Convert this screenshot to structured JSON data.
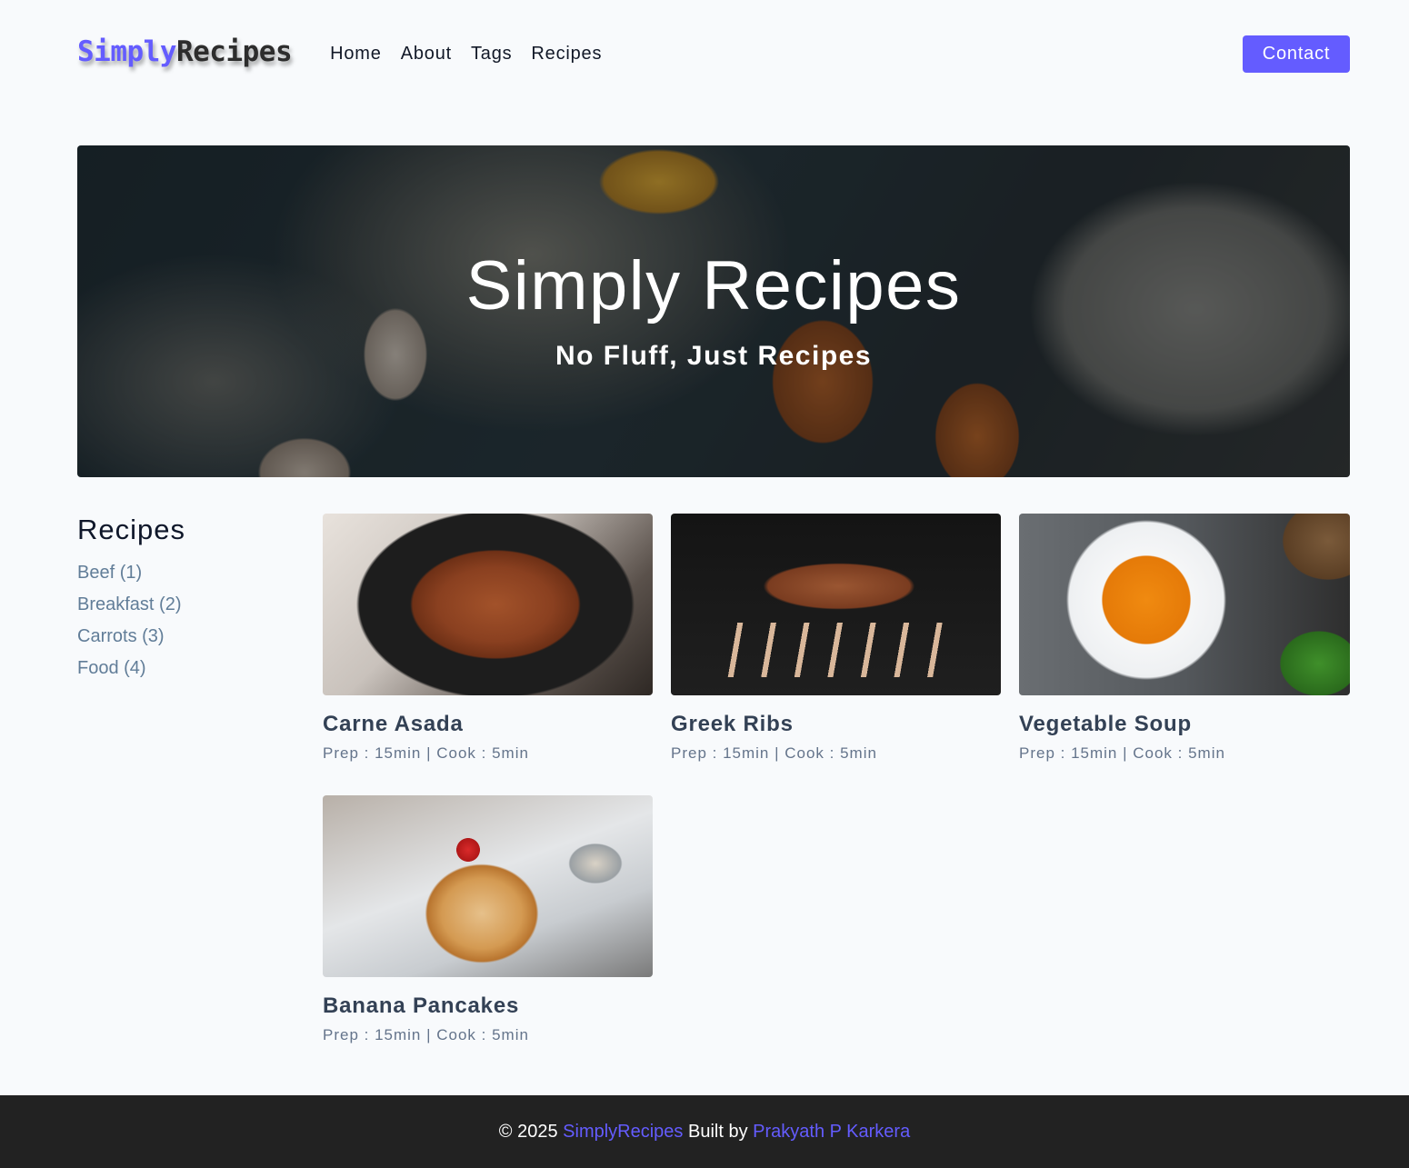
{
  "nav": {
    "logo_part1": "Simply",
    "logo_part2": "Recipes",
    "links": [
      "Home",
      "About",
      "Tags",
      "Recipes"
    ],
    "contact_label": "Contact"
  },
  "hero": {
    "title": "Simply Recipes",
    "subtitle": "No Fluff, Just Recipes"
  },
  "tags": {
    "heading": "Recipes",
    "items": [
      "Beef (1)",
      "Breakfast (2)",
      "Carrots (3)",
      "Food (4)"
    ]
  },
  "recipes": [
    {
      "name": "Carne Asada",
      "meta": "Prep : 15min | Cook : 5min"
    },
    {
      "name": "Greek Ribs",
      "meta": "Prep : 15min | Cook : 5min"
    },
    {
      "name": "Vegetable Soup",
      "meta": "Prep : 15min | Cook : 5min"
    },
    {
      "name": "Banana Pancakes",
      "meta": "Prep : 15min | Cook : 5min"
    }
  ],
  "footer": {
    "copyright": "© 2025",
    "brand": "SimplyRecipes",
    "built_by": "Built by",
    "author": "Prakyath P Karkera"
  },
  "colors": {
    "accent": "#645cff",
    "footer_bg": "#222222",
    "tag_link": "#617d98"
  }
}
